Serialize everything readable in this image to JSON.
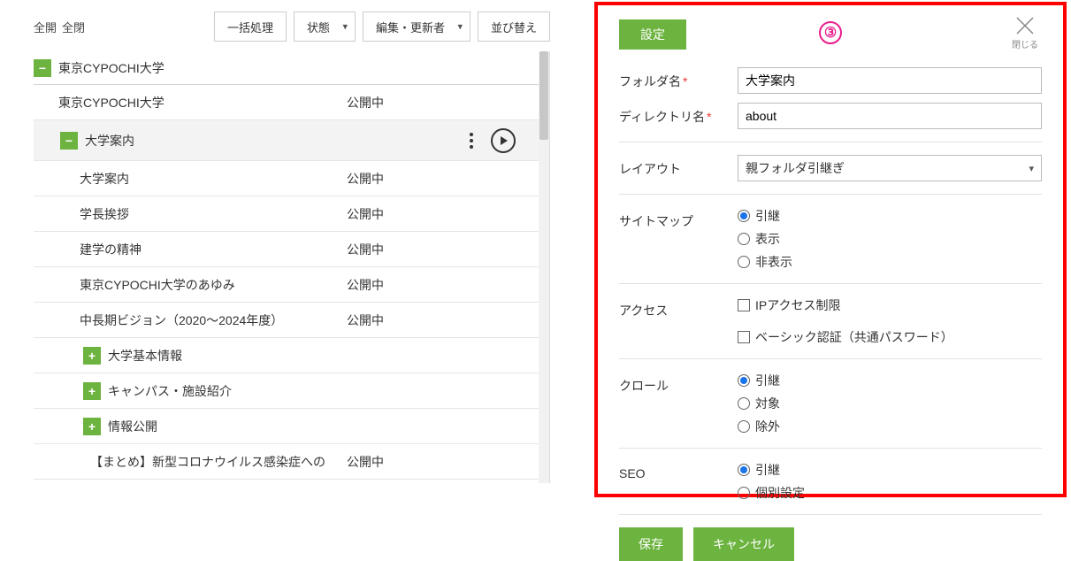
{
  "toolbar": {
    "expand_all": "全開",
    "collapse_all": "全閉",
    "bulk": "一括処理",
    "status": "状態",
    "editor": "編集・更新者",
    "sort": "並び替え"
  },
  "tree": {
    "root": {
      "label": "東京CYPOCHI大学"
    },
    "items": [
      {
        "indent": 1,
        "label": "東京CYPOCHI大学",
        "status": "公開中"
      },
      {
        "indent": 2,
        "label": "大学案内",
        "folder": true,
        "selected": true
      },
      {
        "indent": 3,
        "label": "大学案内",
        "status": "公開中"
      },
      {
        "indent": 3,
        "label": "学長挨拶",
        "status": "公開中"
      },
      {
        "indent": 3,
        "label": "建学の精神",
        "status": "公開中"
      },
      {
        "indent": 3,
        "label": "東京CYPOCHI大学のあゆみ",
        "status": "公開中"
      },
      {
        "indent": 3,
        "label": "中長期ビジョン（2020～2024年度）",
        "status": "公開中"
      },
      {
        "indent": 4,
        "label": "大学基本情報",
        "folder": true,
        "plus": true
      },
      {
        "indent": 4,
        "label": "キャンパス・施設紹介",
        "folder": true,
        "plus": true
      },
      {
        "indent": 4,
        "label": "情報公開",
        "folder": true,
        "plus": true
      },
      {
        "indent": 4,
        "label": "【まとめ】新型コロナウイルス感染症への",
        "status": "公開中"
      }
    ]
  },
  "panel": {
    "tab": "設定",
    "badge": "③",
    "close": "閉じる",
    "fields": {
      "folder_name_label": "フォルダ名",
      "folder_name_value": "大学案内",
      "dir_name_label": "ディレクトリ名",
      "dir_name_value": "about",
      "layout_label": "レイアウト",
      "layout_value": "親フォルダ引継ぎ",
      "sitemap_label": "サイトマップ",
      "sitemap_opts": [
        "引継",
        "表示",
        "非表示"
      ],
      "access_label": "アクセス",
      "access_ip": "IPアクセス制限",
      "access_basic": "ベーシック認証（共通パスワード）",
      "crawl_label": "クロール",
      "crawl_opts": [
        "引継",
        "対象",
        "除外"
      ],
      "seo_label": "SEO",
      "seo_opts": [
        "引継",
        "個別設定"
      ]
    },
    "save": "保存",
    "cancel": "キャンセル"
  }
}
